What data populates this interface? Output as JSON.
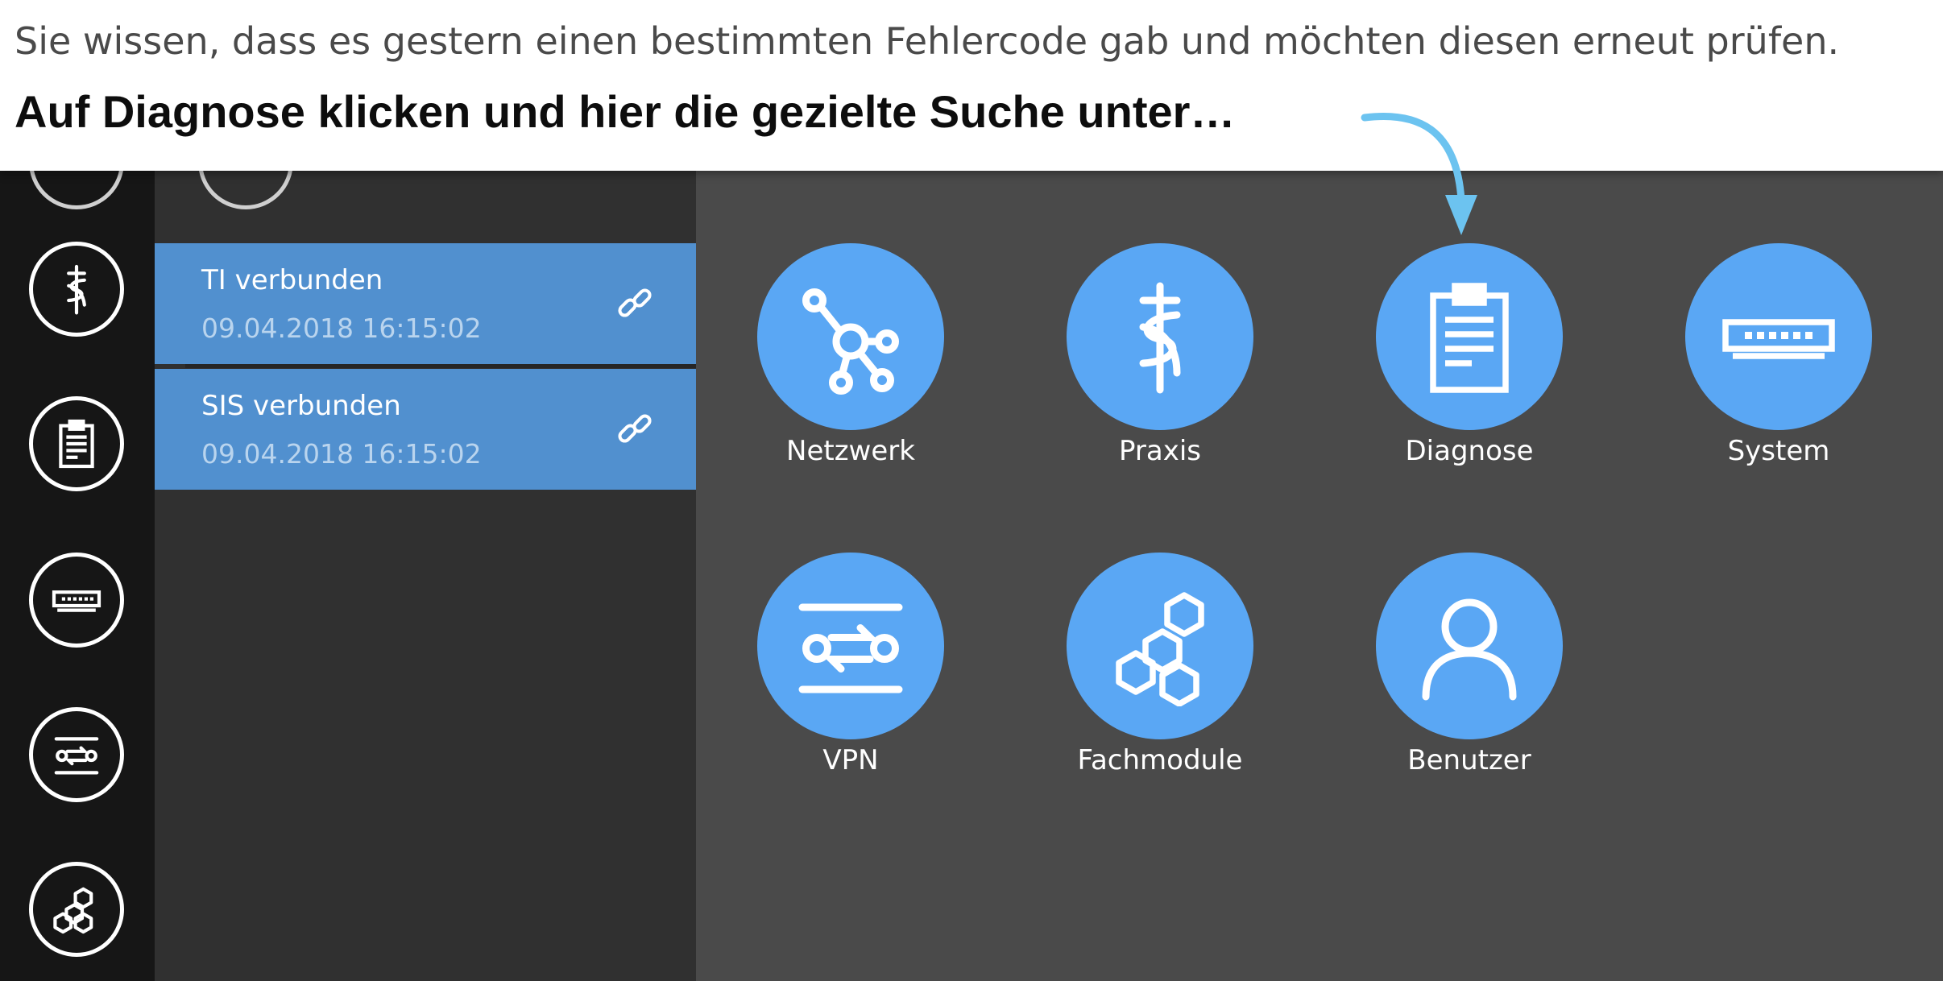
{
  "instruction": {
    "subtitle": "Sie wissen, dass es gestern einen bestimmten Fehlercode gab und möchten diesen erneut prüfen.",
    "heading": "Auf Diagnose klicken und hier die gezielte Suche unter…"
  },
  "sidebar": {
    "items": [
      {
        "icon": "caduceus-icon"
      },
      {
        "icon": "clipboard-icon"
      },
      {
        "icon": "router-icon"
      },
      {
        "icon": "vpn-icon"
      },
      {
        "icon": "hexagons-icon"
      }
    ]
  },
  "connections": [
    {
      "title": "TI verbunden",
      "timestamp": "09.04.2018 16:15:02",
      "icon": "link-icon"
    },
    {
      "title": "SIS verbunden",
      "timestamp": "09.04.2018 16:15:02",
      "icon": "link-icon"
    }
  ],
  "tiles": [
    {
      "label": "Netzwerk",
      "icon": "network-icon"
    },
    {
      "label": "Praxis",
      "icon": "caduceus-icon"
    },
    {
      "label": "Diagnose",
      "icon": "clipboard-icon"
    },
    {
      "label": "System",
      "icon": "router-icon"
    },
    {
      "label": "VPN",
      "icon": "vpn-icon"
    },
    {
      "label": "Fachmodule",
      "icon": "hexagons-icon"
    },
    {
      "label": "Benutzer",
      "icon": "user-icon"
    }
  ],
  "colors": {
    "accent": "#5aa7f4",
    "card": "#5190cf",
    "arrow": "#6cc3f0",
    "rail": "#161616",
    "panel": "#303030",
    "main": "#4a4a4a"
  }
}
